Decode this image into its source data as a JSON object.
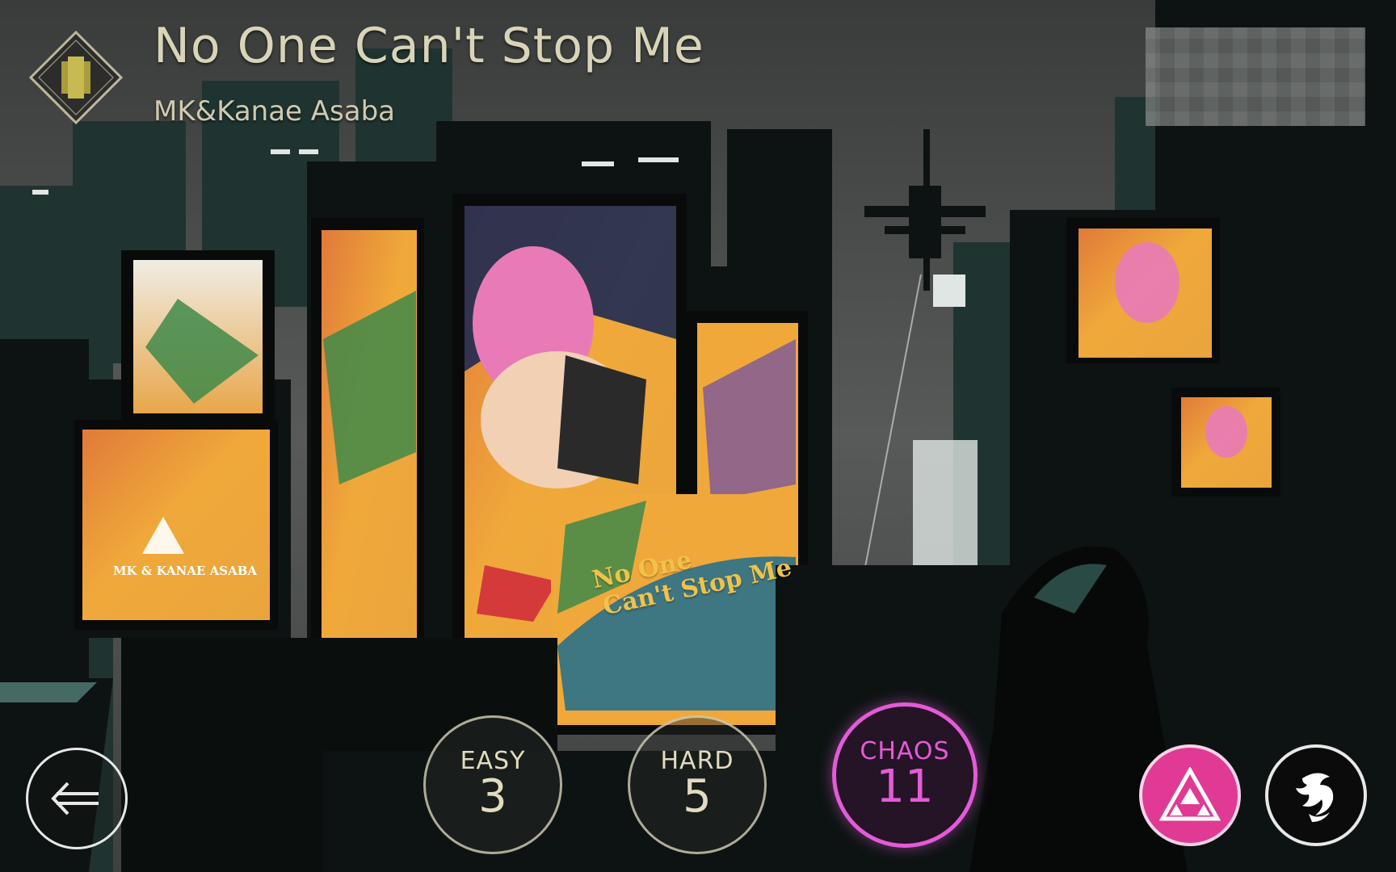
{
  "song": {
    "title": "No One Can't Stop Me",
    "artist": "MK&Kanae Asaba"
  },
  "artwork": {
    "logo_text": "MK & KANAE ASABA",
    "poster_text_line1": "No One",
    "poster_text_line2": "Can't Stop Me"
  },
  "difficulties": [
    {
      "label": "EASY",
      "level": "3",
      "selected": false
    },
    {
      "label": "HARD",
      "level": "5",
      "selected": false
    },
    {
      "label": "CHAOS",
      "level": "11",
      "selected": true
    }
  ],
  "icons": {
    "back": "back-arrow-icon",
    "mode": "triangle-mode-icon",
    "character": "character-emblem-icon",
    "song_badge": "song-badge-icon"
  },
  "colors": {
    "chaos": "#e35bd8",
    "mode_button": "#e03a94",
    "text": "#d9d4b8"
  }
}
